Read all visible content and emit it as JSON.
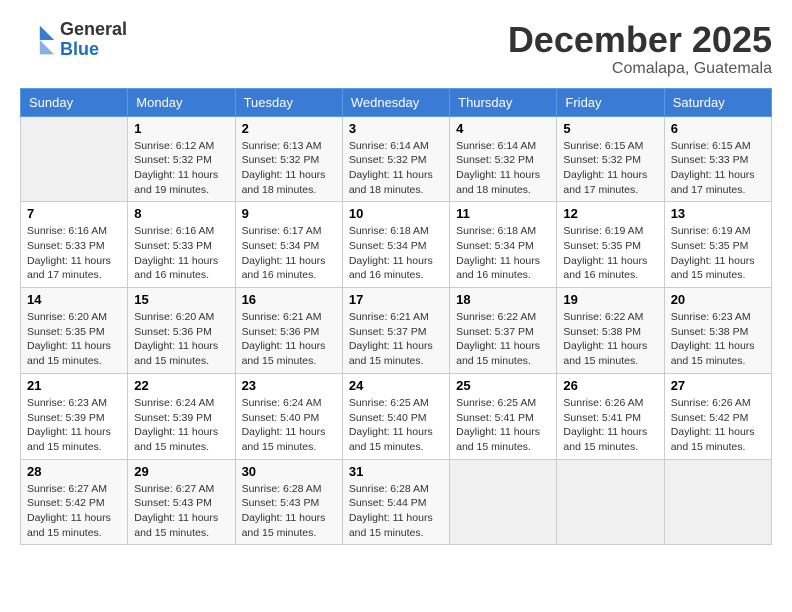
{
  "header": {
    "logo_line1": "General",
    "logo_line2": "Blue",
    "month": "December 2025",
    "location": "Comalapa, Guatemala"
  },
  "weekdays": [
    "Sunday",
    "Monday",
    "Tuesday",
    "Wednesday",
    "Thursday",
    "Friday",
    "Saturday"
  ],
  "weeks": [
    [
      {
        "day": "",
        "sunrise": "",
        "sunset": "",
        "daylight": ""
      },
      {
        "day": "1",
        "sunrise": "Sunrise: 6:12 AM",
        "sunset": "Sunset: 5:32 PM",
        "daylight": "Daylight: 11 hours and 19 minutes."
      },
      {
        "day": "2",
        "sunrise": "Sunrise: 6:13 AM",
        "sunset": "Sunset: 5:32 PM",
        "daylight": "Daylight: 11 hours and 18 minutes."
      },
      {
        "day": "3",
        "sunrise": "Sunrise: 6:14 AM",
        "sunset": "Sunset: 5:32 PM",
        "daylight": "Daylight: 11 hours and 18 minutes."
      },
      {
        "day": "4",
        "sunrise": "Sunrise: 6:14 AM",
        "sunset": "Sunset: 5:32 PM",
        "daylight": "Daylight: 11 hours and 18 minutes."
      },
      {
        "day": "5",
        "sunrise": "Sunrise: 6:15 AM",
        "sunset": "Sunset: 5:32 PM",
        "daylight": "Daylight: 11 hours and 17 minutes."
      },
      {
        "day": "6",
        "sunrise": "Sunrise: 6:15 AM",
        "sunset": "Sunset: 5:33 PM",
        "daylight": "Daylight: 11 hours and 17 minutes."
      }
    ],
    [
      {
        "day": "7",
        "sunrise": "Sunrise: 6:16 AM",
        "sunset": "Sunset: 5:33 PM",
        "daylight": "Daylight: 11 hours and 17 minutes."
      },
      {
        "day": "8",
        "sunrise": "Sunrise: 6:16 AM",
        "sunset": "Sunset: 5:33 PM",
        "daylight": "Daylight: 11 hours and 16 minutes."
      },
      {
        "day": "9",
        "sunrise": "Sunrise: 6:17 AM",
        "sunset": "Sunset: 5:34 PM",
        "daylight": "Daylight: 11 hours and 16 minutes."
      },
      {
        "day": "10",
        "sunrise": "Sunrise: 6:18 AM",
        "sunset": "Sunset: 5:34 PM",
        "daylight": "Daylight: 11 hours and 16 minutes."
      },
      {
        "day": "11",
        "sunrise": "Sunrise: 6:18 AM",
        "sunset": "Sunset: 5:34 PM",
        "daylight": "Daylight: 11 hours and 16 minutes."
      },
      {
        "day": "12",
        "sunrise": "Sunrise: 6:19 AM",
        "sunset": "Sunset: 5:35 PM",
        "daylight": "Daylight: 11 hours and 16 minutes."
      },
      {
        "day": "13",
        "sunrise": "Sunrise: 6:19 AM",
        "sunset": "Sunset: 5:35 PM",
        "daylight": "Daylight: 11 hours and 15 minutes."
      }
    ],
    [
      {
        "day": "14",
        "sunrise": "Sunrise: 6:20 AM",
        "sunset": "Sunset: 5:35 PM",
        "daylight": "Daylight: 11 hours and 15 minutes."
      },
      {
        "day": "15",
        "sunrise": "Sunrise: 6:20 AM",
        "sunset": "Sunset: 5:36 PM",
        "daylight": "Daylight: 11 hours and 15 minutes."
      },
      {
        "day": "16",
        "sunrise": "Sunrise: 6:21 AM",
        "sunset": "Sunset: 5:36 PM",
        "daylight": "Daylight: 11 hours and 15 minutes."
      },
      {
        "day": "17",
        "sunrise": "Sunrise: 6:21 AM",
        "sunset": "Sunset: 5:37 PM",
        "daylight": "Daylight: 11 hours and 15 minutes."
      },
      {
        "day": "18",
        "sunrise": "Sunrise: 6:22 AM",
        "sunset": "Sunset: 5:37 PM",
        "daylight": "Daylight: 11 hours and 15 minutes."
      },
      {
        "day": "19",
        "sunrise": "Sunrise: 6:22 AM",
        "sunset": "Sunset: 5:38 PM",
        "daylight": "Daylight: 11 hours and 15 minutes."
      },
      {
        "day": "20",
        "sunrise": "Sunrise: 6:23 AM",
        "sunset": "Sunset: 5:38 PM",
        "daylight": "Daylight: 11 hours and 15 minutes."
      }
    ],
    [
      {
        "day": "21",
        "sunrise": "Sunrise: 6:23 AM",
        "sunset": "Sunset: 5:39 PM",
        "daylight": "Daylight: 11 hours and 15 minutes."
      },
      {
        "day": "22",
        "sunrise": "Sunrise: 6:24 AM",
        "sunset": "Sunset: 5:39 PM",
        "daylight": "Daylight: 11 hours and 15 minutes."
      },
      {
        "day": "23",
        "sunrise": "Sunrise: 6:24 AM",
        "sunset": "Sunset: 5:40 PM",
        "daylight": "Daylight: 11 hours and 15 minutes."
      },
      {
        "day": "24",
        "sunrise": "Sunrise: 6:25 AM",
        "sunset": "Sunset: 5:40 PM",
        "daylight": "Daylight: 11 hours and 15 minutes."
      },
      {
        "day": "25",
        "sunrise": "Sunrise: 6:25 AM",
        "sunset": "Sunset: 5:41 PM",
        "daylight": "Daylight: 11 hours and 15 minutes."
      },
      {
        "day": "26",
        "sunrise": "Sunrise: 6:26 AM",
        "sunset": "Sunset: 5:41 PM",
        "daylight": "Daylight: 11 hours and 15 minutes."
      },
      {
        "day": "27",
        "sunrise": "Sunrise: 6:26 AM",
        "sunset": "Sunset: 5:42 PM",
        "daylight": "Daylight: 11 hours and 15 minutes."
      }
    ],
    [
      {
        "day": "28",
        "sunrise": "Sunrise: 6:27 AM",
        "sunset": "Sunset: 5:42 PM",
        "daylight": "Daylight: 11 hours and 15 minutes."
      },
      {
        "day": "29",
        "sunrise": "Sunrise: 6:27 AM",
        "sunset": "Sunset: 5:43 PM",
        "daylight": "Daylight: 11 hours and 15 minutes."
      },
      {
        "day": "30",
        "sunrise": "Sunrise: 6:28 AM",
        "sunset": "Sunset: 5:43 PM",
        "daylight": "Daylight: 11 hours and 15 minutes."
      },
      {
        "day": "31",
        "sunrise": "Sunrise: 6:28 AM",
        "sunset": "Sunset: 5:44 PM",
        "daylight": "Daylight: 11 hours and 15 minutes."
      },
      {
        "day": "",
        "sunrise": "",
        "sunset": "",
        "daylight": ""
      },
      {
        "day": "",
        "sunrise": "",
        "sunset": "",
        "daylight": ""
      },
      {
        "day": "",
        "sunrise": "",
        "sunset": "",
        "daylight": ""
      }
    ]
  ]
}
